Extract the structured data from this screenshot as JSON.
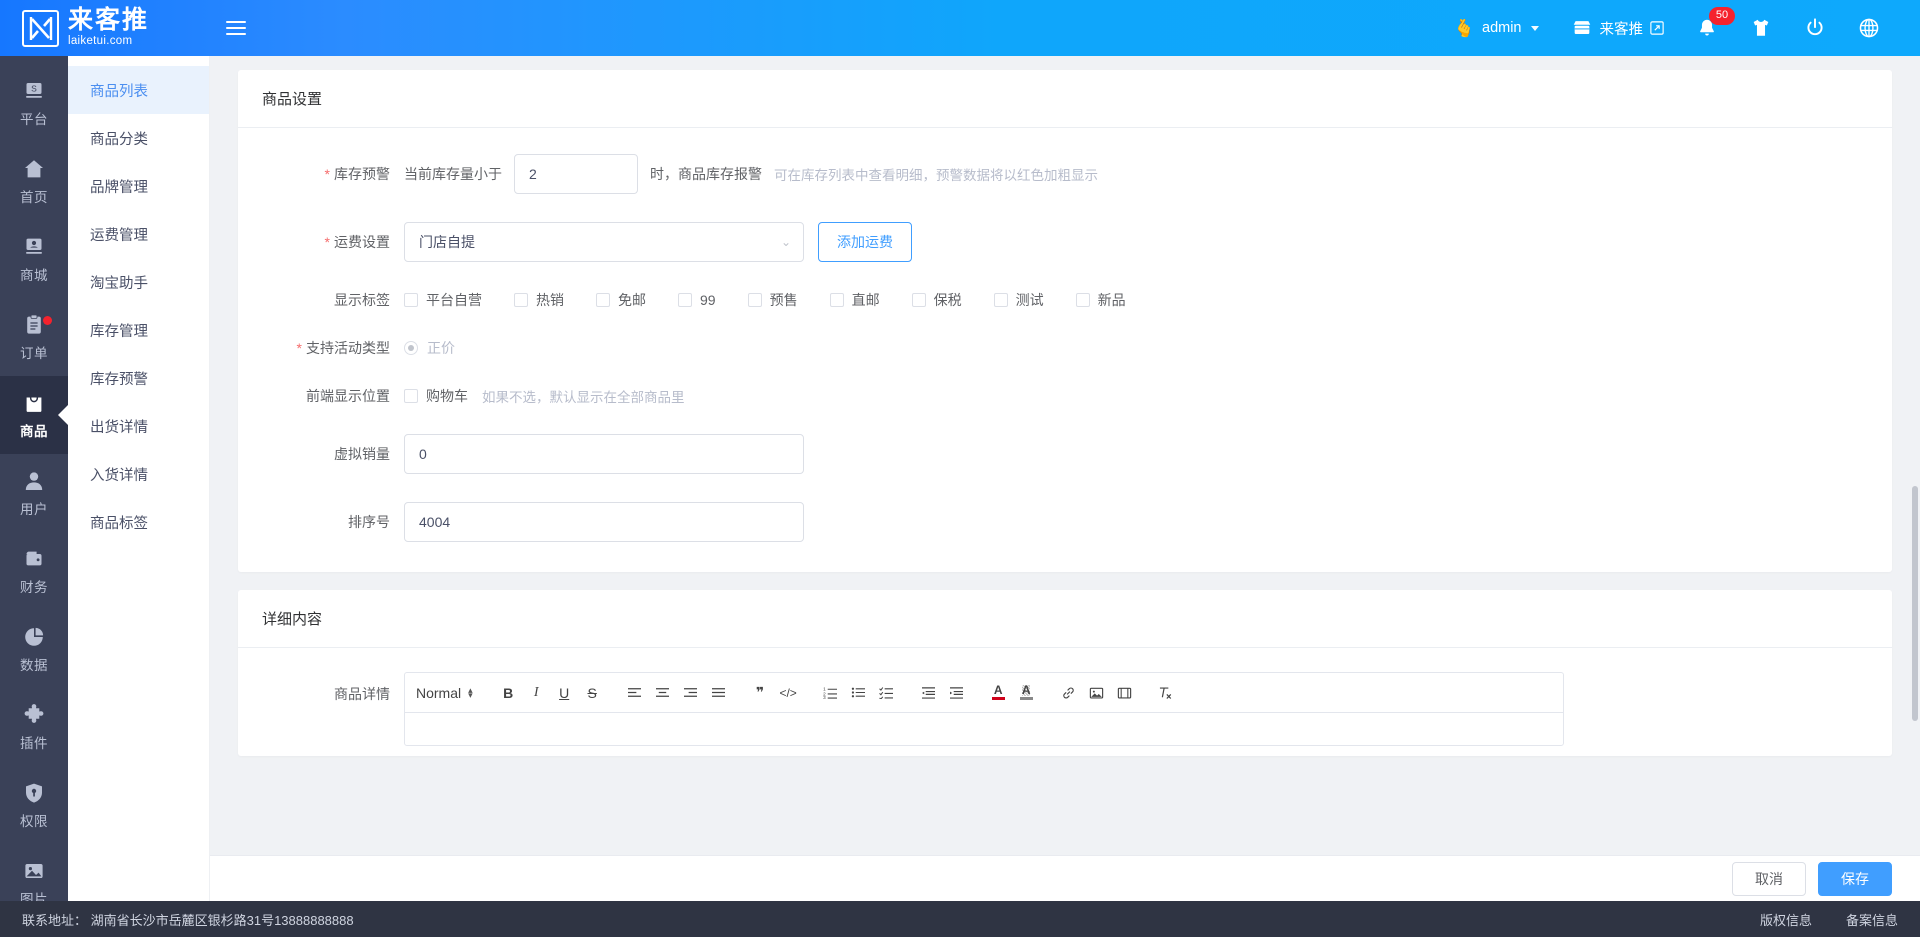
{
  "header": {
    "brand_cn": "来客推",
    "brand_en": "laiketui.com",
    "user": "admin",
    "shop_link": "来客推",
    "notification_count": "50"
  },
  "rail": {
    "items": [
      {
        "label": "平台",
        "icon": "platform-icon",
        "active": false,
        "dot": false
      },
      {
        "label": "首页",
        "icon": "home-icon",
        "active": false,
        "dot": false
      },
      {
        "label": "商城",
        "icon": "mall-icon",
        "active": false,
        "dot": false
      },
      {
        "label": "订单",
        "icon": "order-icon",
        "active": false,
        "dot": true
      },
      {
        "label": "商品",
        "icon": "goods-icon",
        "active": true,
        "dot": false
      },
      {
        "label": "用户",
        "icon": "user-icon",
        "active": false,
        "dot": false
      },
      {
        "label": "财务",
        "icon": "finance-icon",
        "active": false,
        "dot": false
      },
      {
        "label": "数据",
        "icon": "data-icon",
        "active": false,
        "dot": false
      },
      {
        "label": "插件",
        "icon": "plugin-icon",
        "active": false,
        "dot": false
      },
      {
        "label": "权限",
        "icon": "permission-icon",
        "active": false,
        "dot": false
      },
      {
        "label": "图片",
        "icon": "image-icon",
        "active": false,
        "dot": false
      }
    ]
  },
  "submenu": {
    "items": [
      {
        "label": "商品列表",
        "active": true
      },
      {
        "label": "商品分类",
        "active": false
      },
      {
        "label": "品牌管理",
        "active": false
      },
      {
        "label": "运费管理",
        "active": false
      },
      {
        "label": "淘宝助手",
        "active": false
      },
      {
        "label": "库存管理",
        "active": false
      },
      {
        "label": "库存预警",
        "active": false
      },
      {
        "label": "出货详情",
        "active": false
      },
      {
        "label": "入货详情",
        "active": false
      },
      {
        "label": "商品标签",
        "active": false
      }
    ]
  },
  "settings_card": {
    "title": "商品设置",
    "stock_warning": {
      "label": "库存预警",
      "prefix": "当前库存量小于",
      "value": "2",
      "suffix": "时，商品库存报警",
      "hint": "可在库存列表中查看明细，预警数据将以红色加粗显示"
    },
    "freight": {
      "label": "运费设置",
      "value": "门店自提",
      "add_button": "添加运费"
    },
    "tags": {
      "label": "显示标签",
      "options": [
        "平台自营",
        "热销",
        "免邮",
        "99",
        "预售",
        "直邮",
        "保税",
        "测试",
        "新品"
      ]
    },
    "activity_type": {
      "label": "支持活动类型",
      "option": "正价"
    },
    "front_position": {
      "label": "前端显示位置",
      "option": "购物车",
      "hint": "如果不选，默认显示在全部商品里"
    },
    "virtual_sales": {
      "label": "虚拟销量",
      "value": "0"
    },
    "sort_order": {
      "label": "排序号",
      "value": "4004"
    }
  },
  "content_card": {
    "title": "详细内容",
    "detail_label": "商品详情",
    "editor": {
      "format": "Normal",
      "tools": [
        "bold-icon",
        "italic-icon",
        "underline-icon",
        "strikethrough-icon",
        "align-left-icon",
        "align-center-icon",
        "align-right-icon",
        "align-justify-icon",
        "blockquote-icon",
        "code-block-icon",
        "ordered-list-icon",
        "bullet-list-icon",
        "check-list-icon",
        "outdent-icon",
        "indent-icon",
        "font-color-icon",
        "background-color-icon",
        "link-icon",
        "image-icon",
        "video-icon",
        "clear-format-icon"
      ]
    }
  },
  "actions": {
    "cancel": "取消",
    "save": "保存"
  },
  "footer": {
    "contact": "联系地址： 湖南省长沙市岳麓区银杉路31号13888888888",
    "copyright": "版权信息",
    "record": "备案信息"
  },
  "colors": {
    "brand": "#1677ff",
    "accent": "#409eff",
    "rail_bg": "#3a4158",
    "rail_active": "#2b3146",
    "danger": "#f5222d"
  }
}
